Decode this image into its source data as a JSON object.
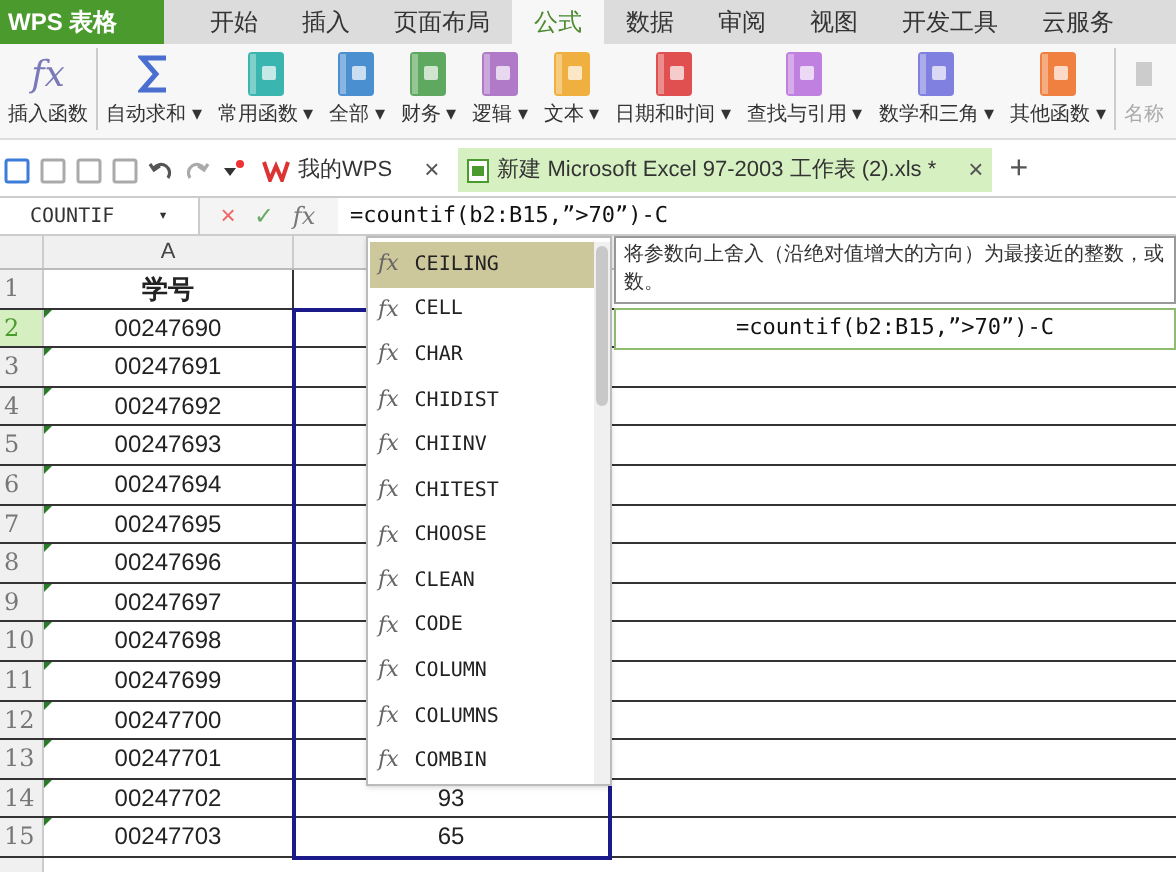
{
  "app_button": {
    "label": "WPS 表格"
  },
  "menu_tabs": [
    {
      "label": "开始",
      "selected": false
    },
    {
      "label": "插入",
      "selected": false
    },
    {
      "label": "页面布局",
      "selected": false
    },
    {
      "label": "公式",
      "selected": true
    },
    {
      "label": "数据",
      "selected": false
    },
    {
      "label": "审阅",
      "selected": false
    },
    {
      "label": "视图",
      "selected": false
    },
    {
      "label": "开发工具",
      "selected": false
    },
    {
      "label": "云服务",
      "selected": false
    }
  ],
  "ribbon": [
    {
      "kind": "fx",
      "icon": "fx",
      "label": "插入函数"
    },
    {
      "kind": "sigma",
      "label": "自动求和",
      "caret": "▾"
    },
    {
      "kind": "book",
      "label": "常用函数",
      "caret": "▾",
      "color": "#3bb5b0"
    },
    {
      "kind": "book",
      "label": "全部",
      "caret": "▾",
      "color": "#4a8fd0"
    },
    {
      "kind": "book",
      "label": "财务",
      "caret": "▾",
      "color": "#5fa85f"
    },
    {
      "kind": "book",
      "label": "逻辑",
      "caret": "▾",
      "color": "#b07ac8"
    },
    {
      "kind": "book",
      "label": "文本",
      "caret": "▾",
      "color": "#f0b040"
    },
    {
      "kind": "book",
      "label": "日期和时间",
      "caret": "▾",
      "color": "#e05050"
    },
    {
      "kind": "book",
      "label": "查找与引用",
      "caret": "▾",
      "color": "#c080e0"
    },
    {
      "kind": "book",
      "label": "数学和三角",
      "caret": "▾",
      "color": "#8080e0"
    },
    {
      "kind": "book",
      "label": "其他函数",
      "caret": "▾",
      "color": "#f08040"
    },
    {
      "kind": "disabled",
      "label": "名称"
    }
  ],
  "doc_tabs": [
    {
      "label": "我的WPS",
      "close": "×",
      "selected": false
    },
    {
      "label": "新建 Microsoft Excel 97-2003 工作表 (2).xls *",
      "close": "×",
      "selected": true
    }
  ],
  "new_tab": "+",
  "formula_bar": {
    "name_box": "COUNTIF",
    "name_caret": "▾",
    "cancel": "×",
    "enter": "✓",
    "fx": "fx",
    "formula": "=countif(b2:B15,”>70”)-C"
  },
  "columns": [
    "A"
  ],
  "rows": [
    {
      "number": "1",
      "a": "学号",
      "b": "",
      "header": true
    },
    {
      "number": "2",
      "a": "00247690",
      "b": "",
      "active": true
    },
    {
      "number": "3",
      "a": "00247691",
      "b": ""
    },
    {
      "number": "4",
      "a": "00247692",
      "b": ""
    },
    {
      "number": "5",
      "a": "00247693",
      "b": ""
    },
    {
      "number": "6",
      "a": "00247694",
      "b": ""
    },
    {
      "number": "7",
      "a": "00247695",
      "b": ""
    },
    {
      "number": "8",
      "a": "00247696",
      "b": ""
    },
    {
      "number": "9",
      "a": "00247697",
      "b": ""
    },
    {
      "number": "10",
      "a": "00247698",
      "b": ""
    },
    {
      "number": "11",
      "a": "00247699",
      "b": ""
    },
    {
      "number": "12",
      "a": "00247700",
      "b": ""
    },
    {
      "number": "13",
      "a": "00247701",
      "b": ""
    },
    {
      "number": "14",
      "a": "00247702",
      "b": "93"
    },
    {
      "number": "15",
      "a": "00247703",
      "b": "65"
    }
  ],
  "edit_cell": {
    "text": "=countif(b2:B15,”>70”)-C"
  },
  "autocomplete": {
    "items": [
      {
        "icon": "fx",
        "label": "CEILING",
        "selected": true
      },
      {
        "icon": "fx",
        "label": "CELL",
        "selected": false
      },
      {
        "icon": "fx",
        "label": "CHAR",
        "selected": false
      },
      {
        "icon": "fx",
        "label": "CHIDIST",
        "selected": false
      },
      {
        "icon": "fx",
        "label": "CHIINV",
        "selected": false
      },
      {
        "icon": "fx",
        "label": "CHITEST",
        "selected": false
      },
      {
        "icon": "fx",
        "label": "CHOOSE",
        "selected": false
      },
      {
        "icon": "fx",
        "label": "CLEAN",
        "selected": false
      },
      {
        "icon": "fx",
        "label": "CODE",
        "selected": false
      },
      {
        "icon": "fx",
        "label": "COLUMN",
        "selected": false
      },
      {
        "icon": "fx",
        "label": "COLUMNS",
        "selected": false
      },
      {
        "icon": "fx",
        "label": "COMBIN",
        "selected": false
      }
    ]
  },
  "tooltip": {
    "lines": [
      "将参数向上舍入（沿绝对值增大的方向）为最接近的整数，或",
      "数。"
    ]
  }
}
